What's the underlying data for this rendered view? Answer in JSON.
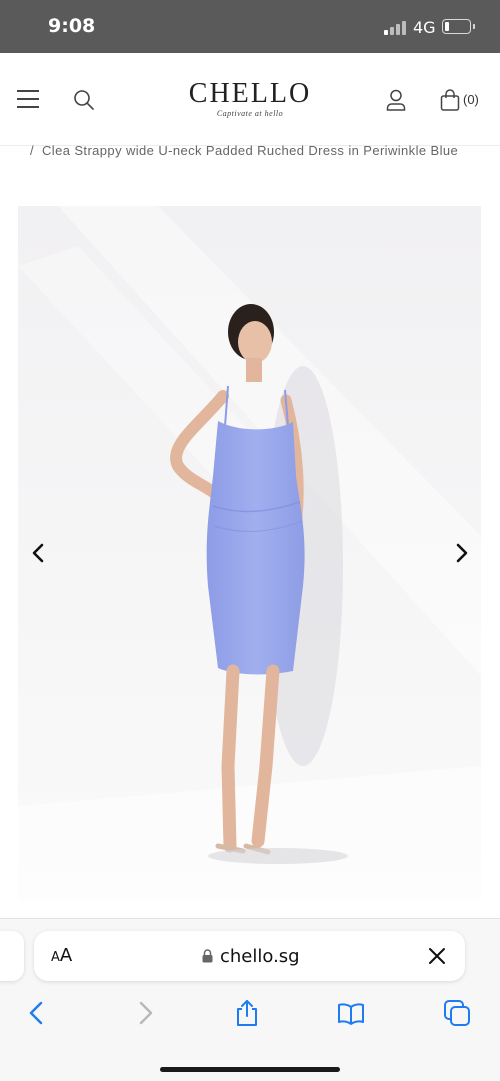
{
  "status_bar": {
    "time": "9:08",
    "network": "4G",
    "signal_bars": 4,
    "signal_bars_active": 1
  },
  "header": {
    "logo_text": "CHELLO",
    "logo_tagline": "Captivate at hello",
    "cart_count": "(0)",
    "icons": [
      "menu-icon",
      "search-icon",
      "account-icon",
      "shopping-bag-icon"
    ]
  },
  "breadcrumb": {
    "separator": "/",
    "current": "Clea Strappy wide U-neck Padded Ruched Dress in Periwinkle Blue"
  },
  "product_image": {
    "dress_color": "#9aa9ec",
    "background_color": "#f3f2f4",
    "prev_icon": "chevron-left-icon",
    "next_icon": "chevron-right-icon"
  },
  "safari": {
    "text_size_button": "AA",
    "url": "chello.sg",
    "toolbar_icons": [
      "back-icon",
      "forward-icon",
      "share-icon",
      "bookmarks-icon",
      "tabs-icon"
    ],
    "accent_color": "#1f7bf2"
  }
}
